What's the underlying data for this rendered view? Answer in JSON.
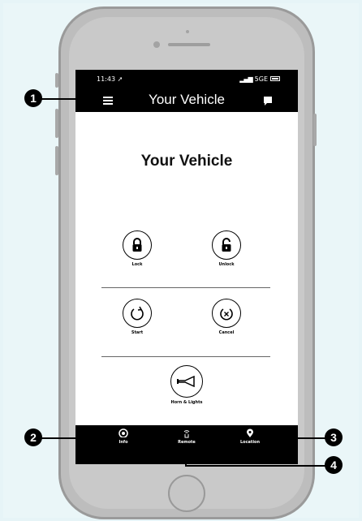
{
  "status_bar": {
    "time": "11:43 ➚",
    "network": "5GE"
  },
  "header": {
    "title": "Your Vehicle"
  },
  "main": {
    "title": "Your Vehicle"
  },
  "controls": {
    "lock": "Lock",
    "unlock": "Unlock",
    "start": "Start",
    "cancel": "Cancel",
    "horn": "Horn & Lights"
  },
  "bottom_nav": [
    {
      "label": "Info",
      "icon": "info-icon"
    },
    {
      "label": "Remote",
      "icon": "remote-icon"
    },
    {
      "label": "Location",
      "icon": "location-pin-icon"
    }
  ],
  "callouts": [
    "1",
    "2",
    "3",
    "4"
  ]
}
